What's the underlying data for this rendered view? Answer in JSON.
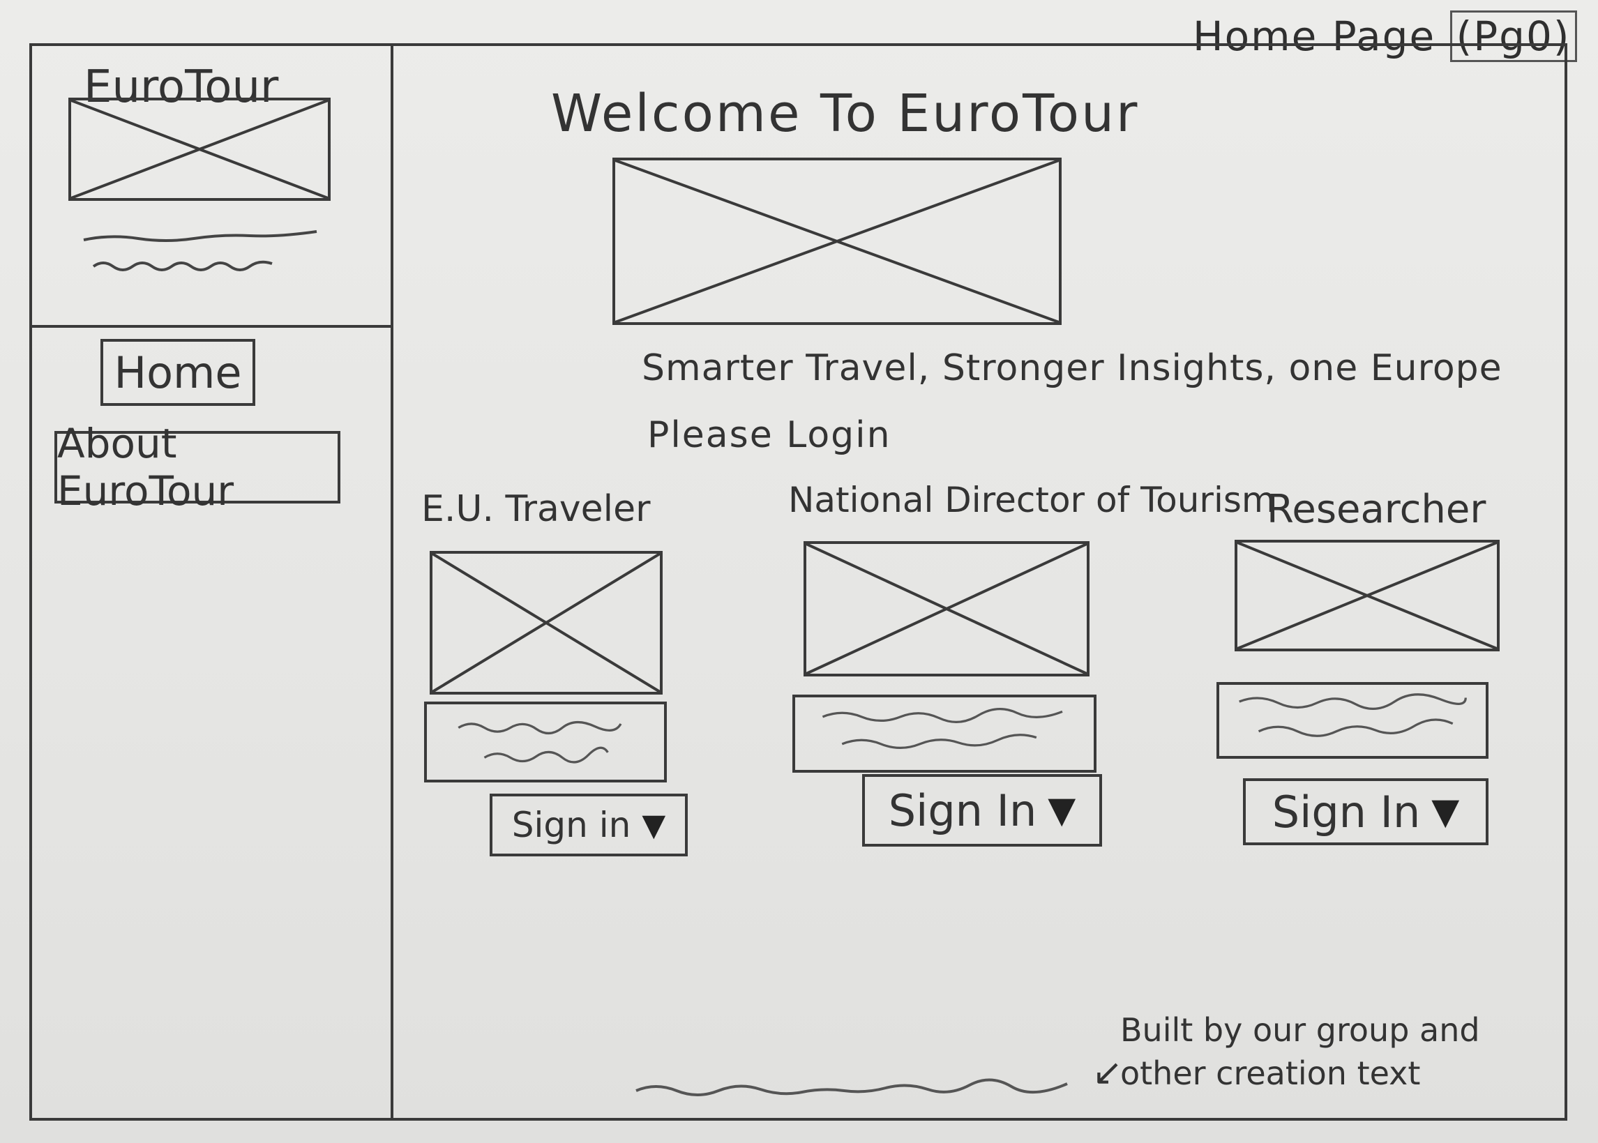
{
  "page_label": {
    "text": "Home Page",
    "page_tag": "(Pg0)"
  },
  "sidebar": {
    "brand": "EuroTour",
    "nav": [
      {
        "label": "Home"
      },
      {
        "label": "About EuroTour"
      }
    ]
  },
  "main": {
    "title": "Welcome To EuroTour",
    "tagline": "Smarter Travel, Stronger Insights, one Europe",
    "login_prompt": "Please Login",
    "roles": [
      {
        "label": "E.U. Traveler",
        "button": "Sign in"
      },
      {
        "label": "National Director of Tourism",
        "button": "Sign In"
      },
      {
        "label": "Researcher",
        "button": "Sign In"
      }
    ],
    "footer_note": "Built by our group and other creation text"
  },
  "icons": {
    "dropdown": "caret-down-icon",
    "image_placeholder": "image-placeholder-icon"
  },
  "colors": {
    "ink": "#3a3a3a",
    "paper": "#e8e8e6"
  }
}
